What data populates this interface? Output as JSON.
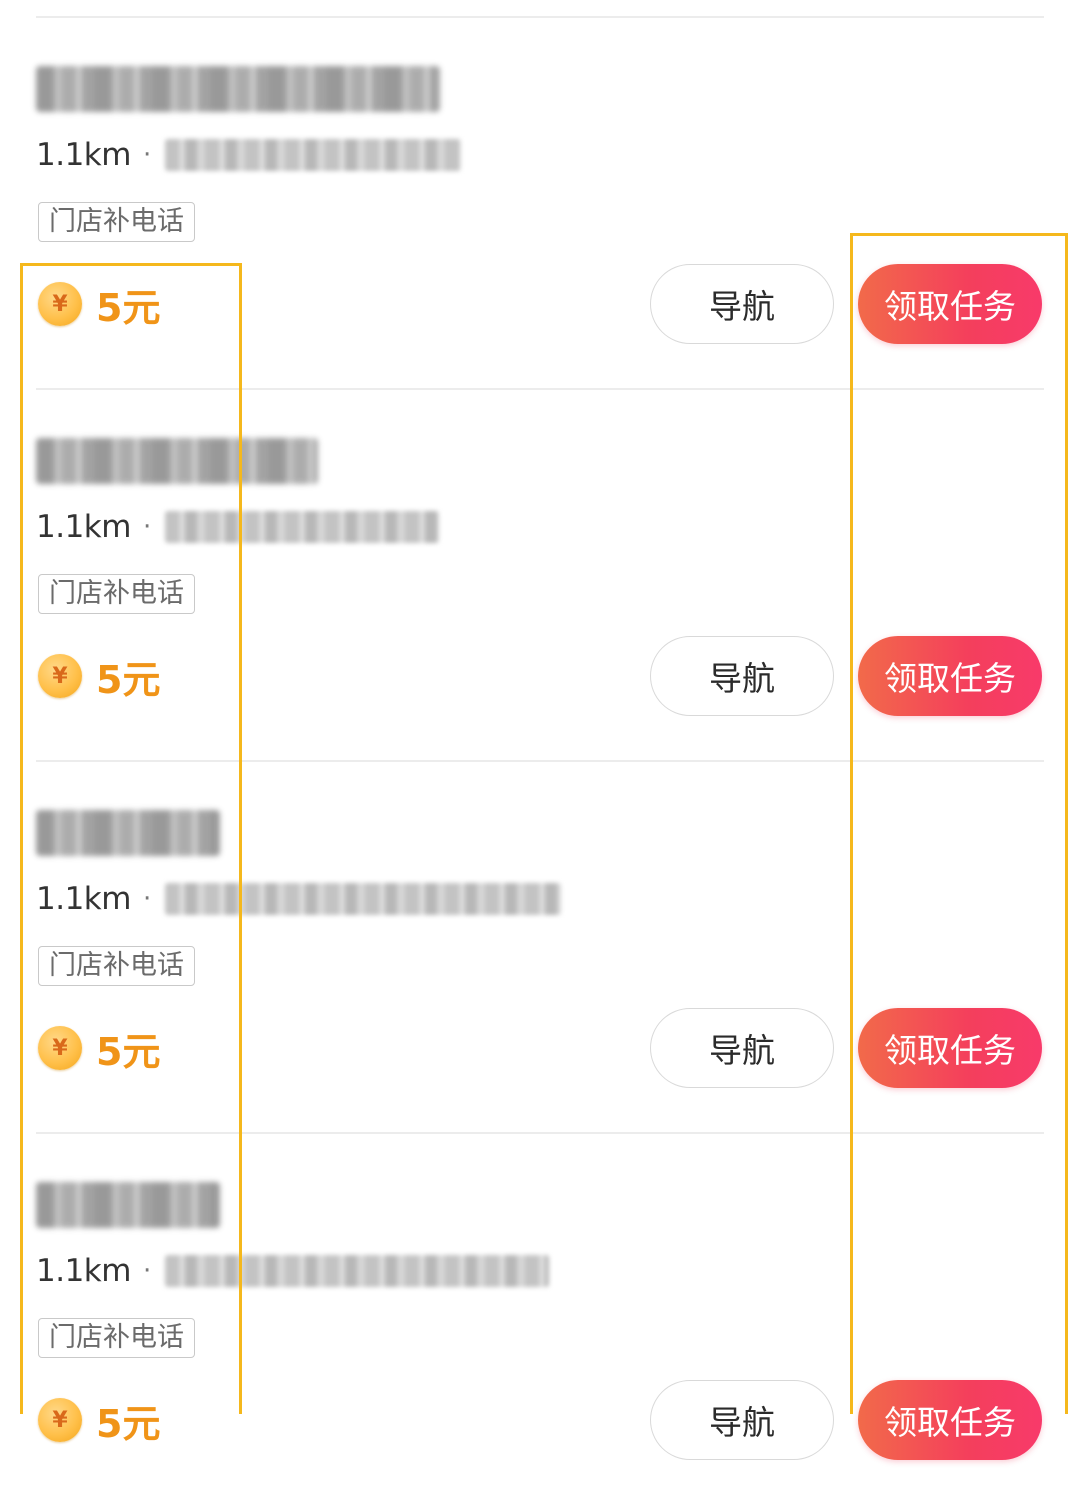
{
  "colors": {
    "accent_reward": "#f09418",
    "claim_button_gradient": [
      "#f26a4a",
      "#f83a6a"
    ],
    "highlight_frame": "#f5b81c",
    "divider": "#ececec"
  },
  "tasks": [
    {
      "distance": "1.1km",
      "separator": "·",
      "tag": "门店补电话",
      "reward": "5元",
      "coin_symbol": "¥",
      "nav_label": "导航",
      "claim_label": "领取任务"
    },
    {
      "distance": "1.1km",
      "separator": "·",
      "tag": "门店补电话",
      "reward": "5元",
      "coin_symbol": "¥",
      "nav_label": "导航",
      "claim_label": "领取任务"
    },
    {
      "distance": "1.1km",
      "separator": "·",
      "tag": "门店补电话",
      "reward": "5元",
      "coin_symbol": "¥",
      "nav_label": "导航",
      "claim_label": "领取任务"
    },
    {
      "distance": "1.1km",
      "separator": "·",
      "tag": "门店补电话",
      "reward": "5元",
      "coin_symbol": "¥",
      "nav_label": "导航",
      "claim_label": "领取任务"
    }
  ]
}
